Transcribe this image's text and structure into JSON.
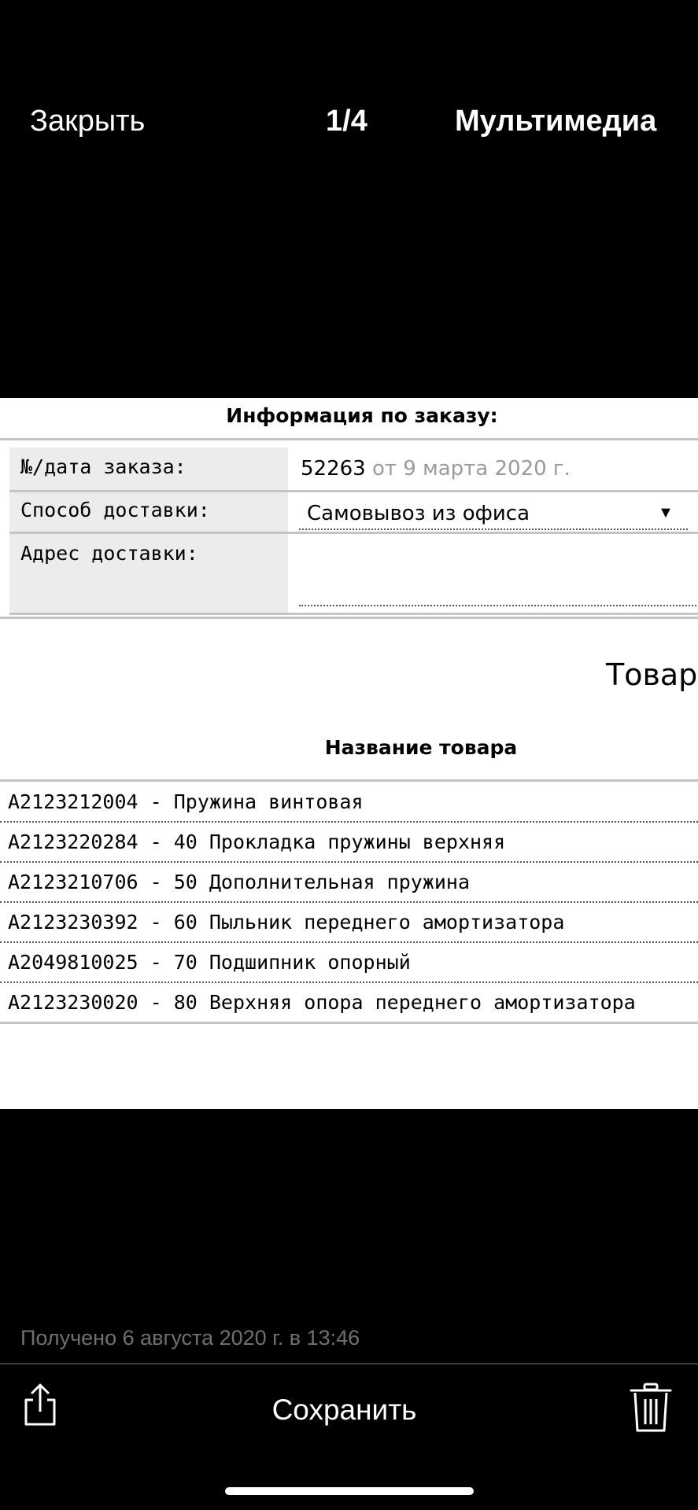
{
  "header": {
    "close_label": "Закрыть",
    "counter": "1/4",
    "media_label": "Мультимедиа"
  },
  "document": {
    "title": "Информация по заказу:",
    "order_label": "№/дата заказа:",
    "order_number": "52263",
    "order_date": "от 9 марта 2020 г.",
    "delivery_method_label": "Способ доставки:",
    "delivery_method_value": "Самовывоз из офиса",
    "delivery_address_label": "Адрес доставки:",
    "delivery_address_value": "",
    "goods_heading": "Товары",
    "column_header": "Название товара",
    "items": [
      "A2123212004 - Пружина винтовая",
      "A2123220284 - 40 Прокладка пружины верхняя",
      "A2123210706 - 50 Дополнительная пружина",
      "A2123230392 - 60 Пыльник переднего амортизатора",
      "A2049810025 - 70 Подшипник опорный",
      "A2123230020 - 80 Верхняя опора переднего амортизатора"
    ]
  },
  "footer": {
    "received_text": "Получено 6 августа 2020 г. в 13:46",
    "save_label": "Сохранить",
    "share_icon": "share-icon",
    "trash_icon": "trash-icon"
  }
}
